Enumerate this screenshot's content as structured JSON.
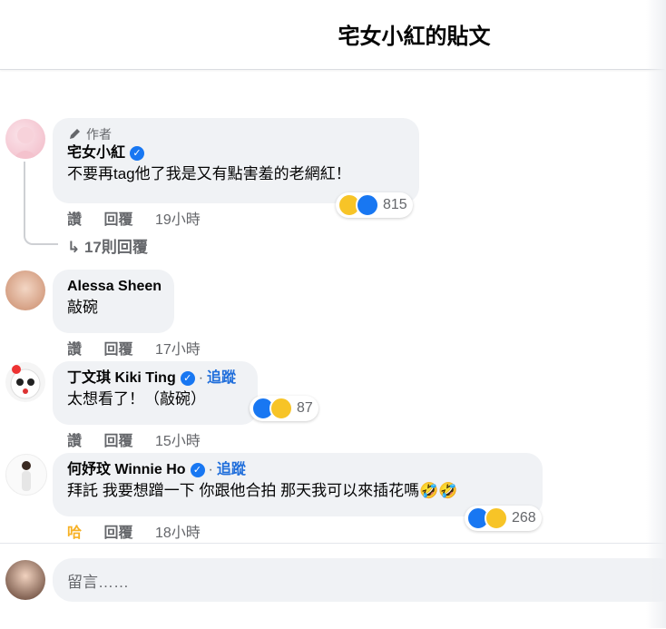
{
  "header": {
    "title": "宅女小紅的貼文"
  },
  "comments": [
    {
      "author_tag": "作者",
      "name": "宅女小紅",
      "text": "不要再tag他了我是又有點害羞的老網紅！",
      "actions": {
        "like": "讚",
        "reply": "回覆",
        "time": "19小時"
      },
      "react_count": "815",
      "replies_label": "17則回覆"
    },
    {
      "name": "Alessa Sheen",
      "text": "敲碗",
      "actions": {
        "like": "讚",
        "reply": "回覆",
        "time": "17小時"
      }
    },
    {
      "name": "丁文琪 Kiki Ting",
      "follow": "追蹤",
      "text": "太想看了！（敲碗）",
      "actions": {
        "like": "讚",
        "reply": "回覆",
        "time": "15小時"
      },
      "react_count": "87"
    },
    {
      "name": "何妤玟 Winnie Ho",
      "follow": "追蹤",
      "text": "拜託 我要想蹭一下 你跟他合拍 那天我可以來插花嗎🤣🤣",
      "actions": {
        "like": "哈",
        "reply": "回覆",
        "time": "18小時"
      },
      "react_count": "268"
    }
  ],
  "composer": {
    "placeholder": "留言……"
  },
  "colors": {
    "accent": "#1877f2",
    "bubble": "#f0f2f5",
    "muted": "#65676b",
    "haha": "#f7b125"
  }
}
